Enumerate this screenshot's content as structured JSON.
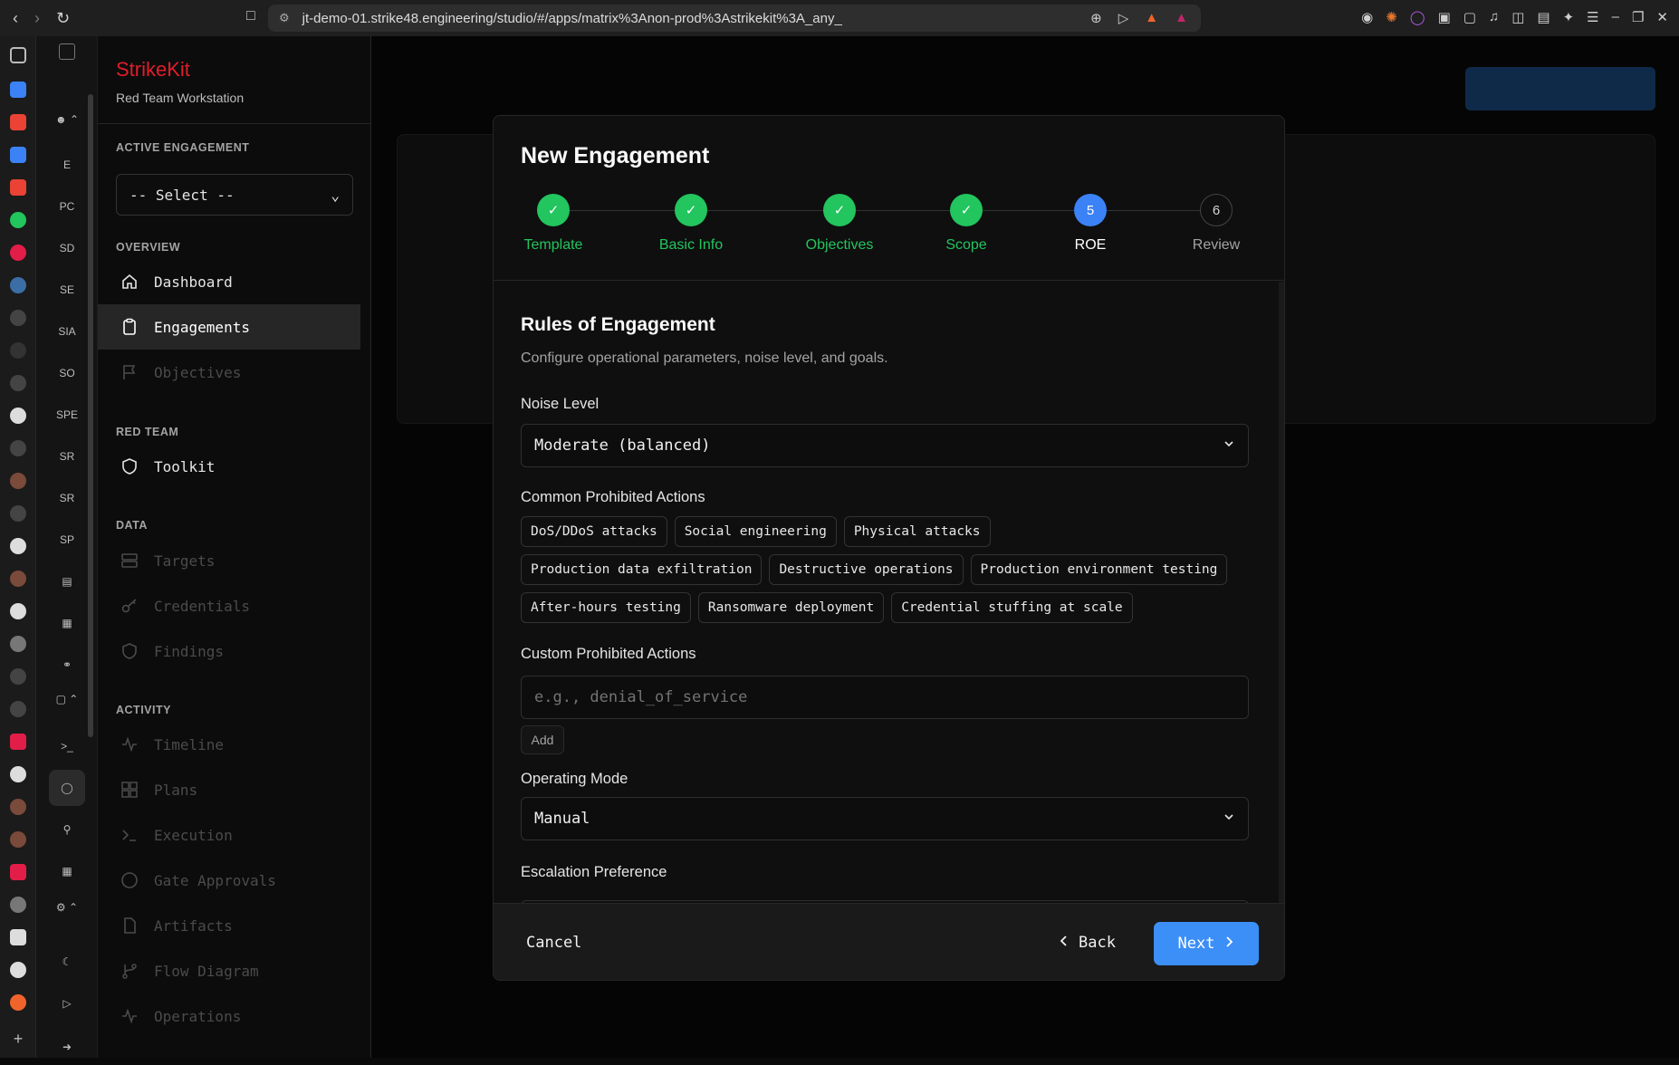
{
  "browser": {
    "url": "jt-demo-01.strike48.engineering/studio/#/apps/matrix%3Anon-prod%3Astrikekit%3A_any_"
  },
  "rail2": {
    "items": [
      "E",
      "PC",
      "SD",
      "SE",
      "SIA",
      "SO",
      "SPE",
      "SR",
      "SR",
      "SP"
    ]
  },
  "sidebar": {
    "brand_name": "StrikeKit",
    "brand_sub": "Red Team Workstation",
    "active_engagement_label": "ACTIVE ENGAGEMENT",
    "engagement_select_value": "-- Select --",
    "sections": {
      "overview": "OVERVIEW",
      "red_team": "RED TEAM",
      "data": "DATA",
      "activity": "ACTIVITY"
    },
    "items": {
      "dashboard": "Dashboard",
      "engagements": "Engagements",
      "objectives": "Objectives",
      "toolkit": "Toolkit",
      "targets": "Targets",
      "credentials": "Credentials",
      "findings": "Findings",
      "timeline": "Timeline",
      "plans": "Plans",
      "execution": "Execution",
      "gate_approvals": "Gate Approvals",
      "artifacts": "Artifacts",
      "flow_diagram": "Flow Diagram",
      "operations": "Operations"
    }
  },
  "modal": {
    "title": "New Engagement",
    "steps": [
      {
        "label": "Template",
        "state": "done"
      },
      {
        "label": "Basic Info",
        "state": "done"
      },
      {
        "label": "Objectives",
        "state": "done"
      },
      {
        "label": "Scope",
        "state": "done"
      },
      {
        "label": "ROE",
        "state": "current",
        "number": "5"
      },
      {
        "label": "Review",
        "state": "todo",
        "number": "6"
      }
    ],
    "section_title": "Rules of Engagement",
    "section_desc": "Configure operational parameters, noise level, and goals.",
    "noise_level_label": "Noise Level",
    "noise_level_value": "Moderate (balanced)",
    "common_prohibited_label": "Common Prohibited Actions",
    "common_prohibited": [
      [
        "DoS/DDoS attacks",
        "Social engineering",
        "Physical attacks"
      ],
      [
        "Production data exfiltration",
        "Destructive operations",
        "Production environment testing"
      ],
      [
        "After-hours testing",
        "Ransomware deployment",
        "Credential stuffing at scale"
      ]
    ],
    "custom_prohibited_label": "Custom Prohibited Actions",
    "custom_prohibited_placeholder": "e.g., denial_of_service",
    "add_label": "Add",
    "operating_mode_label": "Operating Mode",
    "operating_mode_value": "Manual",
    "escalation_label": "Escalation Preference",
    "cancel_label": "Cancel",
    "back_label": "Back",
    "next_label": "Next"
  },
  "colors": {
    "brand": "#e11d2a",
    "done": "#22c55e",
    "current": "#3b82f6",
    "primary_button": "#3b8ff6"
  }
}
